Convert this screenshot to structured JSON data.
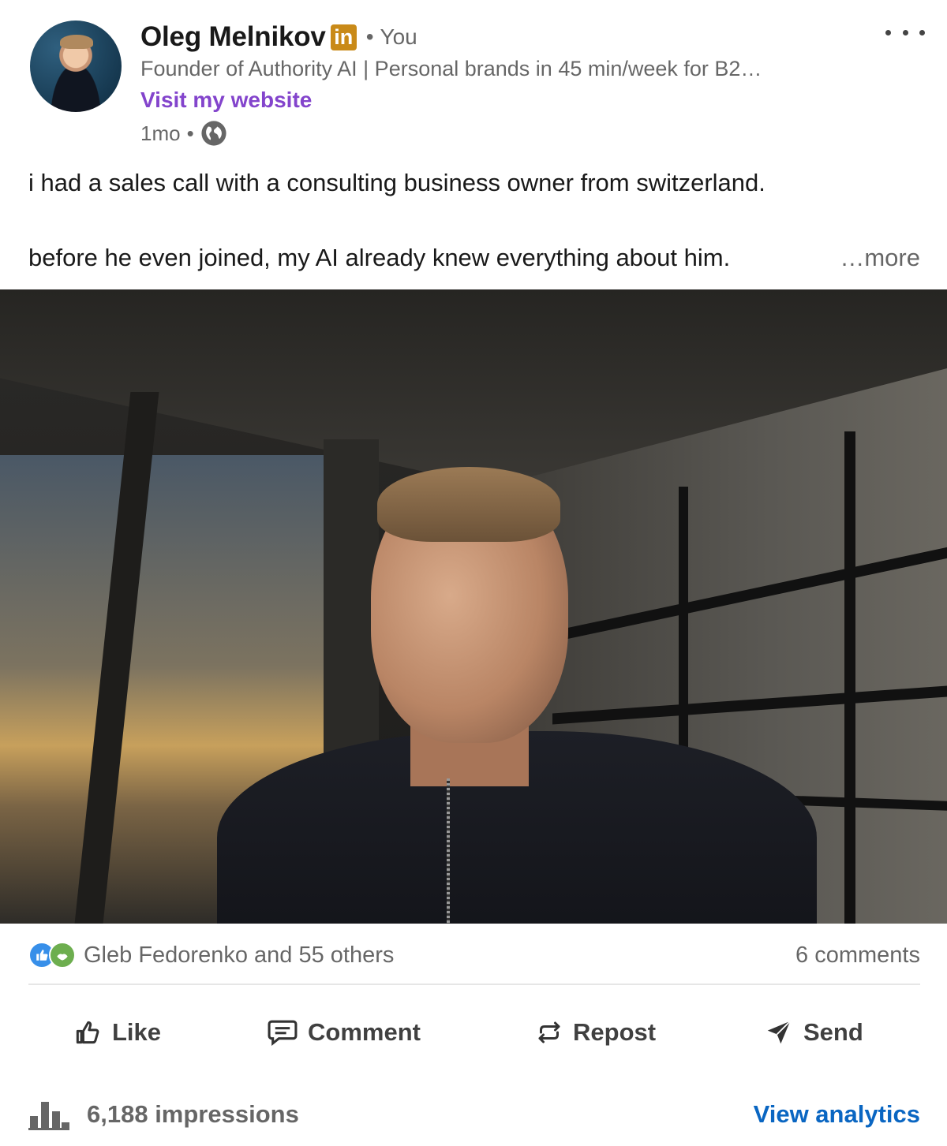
{
  "author": {
    "name": "Oleg Melnikov",
    "badge": "in",
    "relation": "You",
    "headline": "Founder of Authority AI | Personal brands in 45 min/week for B2…",
    "link_label": "Visit my website",
    "time": "1mo",
    "visibility_icon": "globe-icon"
  },
  "post": {
    "paragraphs": [
      "i had a sales call with a consulting business owner from switzerland.",
      "before he even joined, my AI already knew everything about him."
    ],
    "more_label": "…more"
  },
  "social": {
    "reactions_text": "Gleb Fedorenko and 55 others",
    "comments_text": "6 comments"
  },
  "actions": {
    "like": "Like",
    "comment": "Comment",
    "repost": "Repost",
    "send": "Send"
  },
  "stats": {
    "impressions": "6,188 impressions",
    "analytics_label": "View analytics"
  },
  "colors": {
    "link_purple": "#8344cc",
    "linkedin_blue": "#0a66c2",
    "badge_gold": "#c98a18"
  }
}
